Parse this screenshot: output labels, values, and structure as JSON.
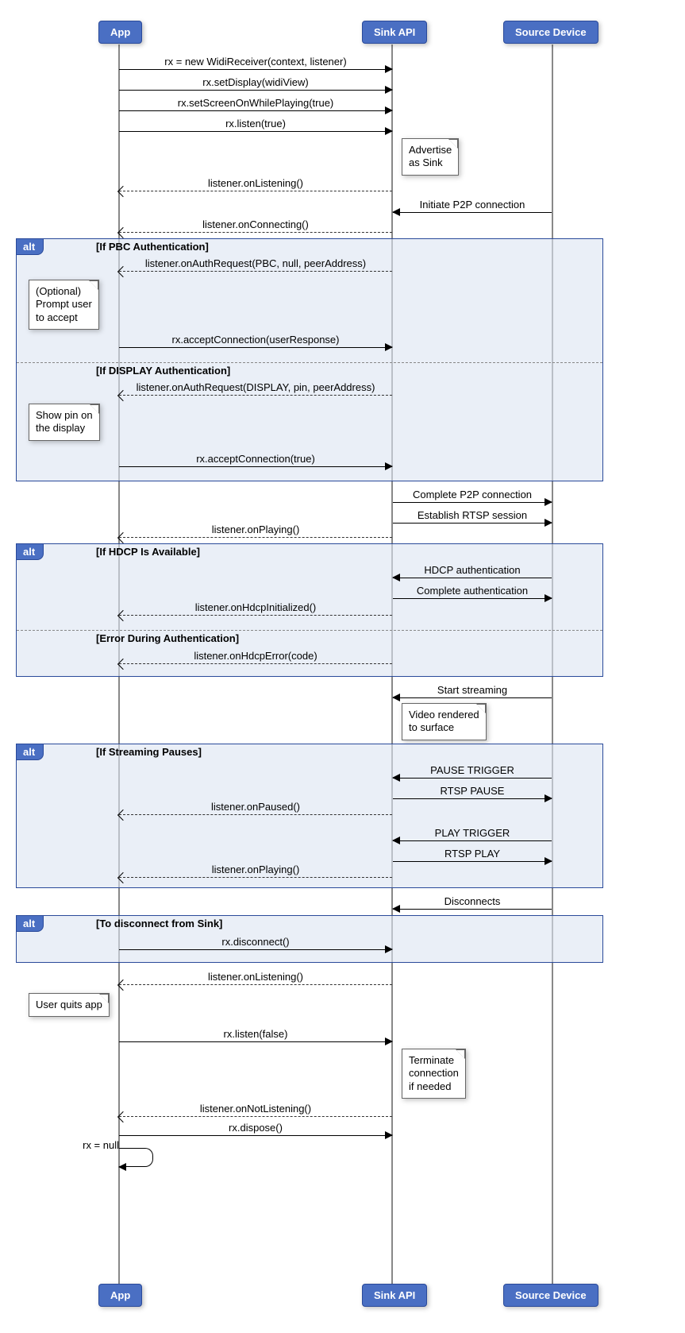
{
  "participants": {
    "app": "App",
    "sink": "Sink API",
    "source": "Source Device"
  },
  "messages": {
    "m1": "rx = new WidiReceiver(context, listener)",
    "m2": "rx.setDisplay(widiView)",
    "m3": "rx.setScreenOnWhilePlaying(true)",
    "m4": "rx.listen(true)",
    "m5": "listener.onListening()",
    "m6": "Initiate P2P connection",
    "m7": "listener.onConnecting()",
    "m8": "listener.onAuthRequest(PBC, null, peerAddress)",
    "m9": "rx.acceptConnection(userResponse)",
    "m10": "listener.onAuthRequest(DISPLAY, pin, peerAddress)",
    "m11": "rx.acceptConnection(true)",
    "m12": "Complete P2P connection",
    "m13": "Establish RTSP session",
    "m14": "listener.onPlaying()",
    "m15": "HDCP authentication",
    "m16": "Complete authentication",
    "m17": "listener.onHdcpInitialized()",
    "m18": "listener.onHdcpError(code)",
    "m19": "Start streaming",
    "m20": "PAUSE TRIGGER",
    "m21": "RTSP PAUSE",
    "m22": "listener.onPaused()",
    "m23": "PLAY TRIGGER",
    "m24": "RTSP PLAY",
    "m25": "listener.onPlaying()",
    "m26": "Disconnects",
    "m27": "rx.disconnect()",
    "m28": "listener.onListening()",
    "m29": "rx.listen(false)",
    "m30": "listener.onNotListening()",
    "m31": "rx.dispose()",
    "m32": "rx = null"
  },
  "alts": {
    "a1": {
      "tag": "alt",
      "title1": "[If PBC Authentication]",
      "title2": "[If DISPLAY Authentication]"
    },
    "a2": {
      "tag": "alt",
      "title1": "[If HDCP Is Available]",
      "title2": "[Error During Authentication]"
    },
    "a3": {
      "tag": "alt",
      "title1": "[If Streaming Pauses]"
    },
    "a4": {
      "tag": "alt",
      "title1": "[To disconnect from Sink]"
    }
  },
  "notes": {
    "n1": "Advertise\nas Sink",
    "n2": "(Optional)\nPrompt user\nto accept",
    "n3": "Show pin on\nthe display",
    "n4": "Video rendered\nto surface",
    "n5": "User quits app",
    "n6": "Terminate\nconnection\nif needed"
  }
}
